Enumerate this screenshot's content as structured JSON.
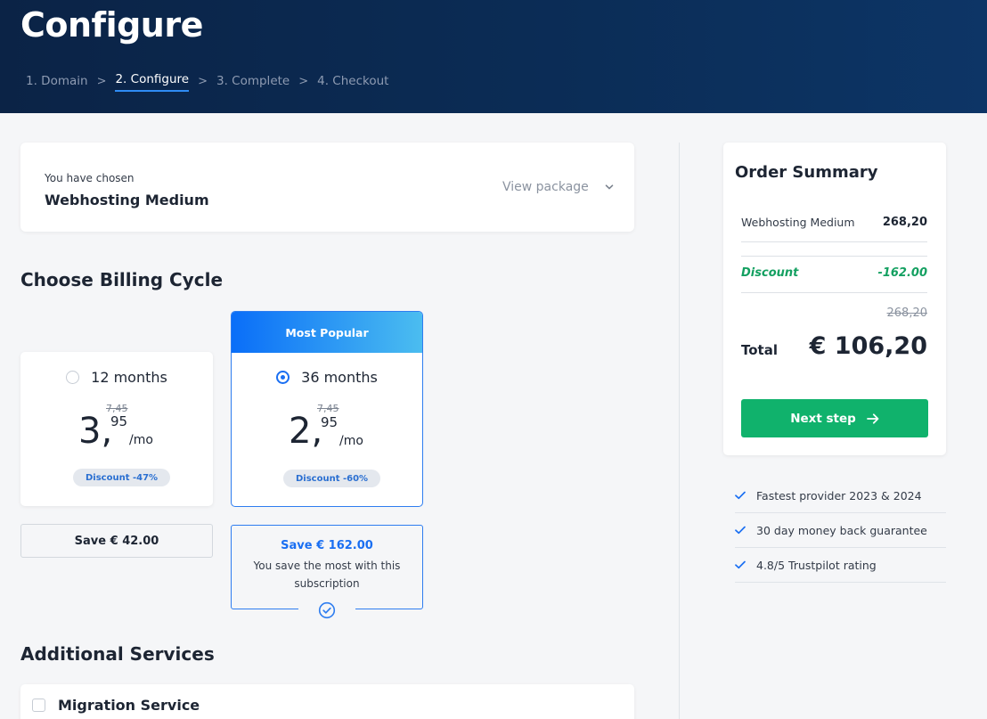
{
  "header": {
    "title": "Configure",
    "breadcrumbs": [
      "1. Domain",
      "2. Configure",
      "3. Complete",
      "4. Checkout"
    ],
    "active_step": 1
  },
  "chosen": {
    "intro": "You have chosen",
    "package": "Webhosting Medium",
    "view_label": "View package"
  },
  "billing": {
    "title": "Choose Billing Cycle",
    "plans": [
      {
        "label": "12 months",
        "selected": false,
        "old_price": "7,45",
        "price_main": "3,",
        "price_cents": "95",
        "per": "/mo",
        "discount": "Discount -47%",
        "save": "Save € 42.00"
      },
      {
        "label": "36 months",
        "selected": true,
        "badge": "Most Popular",
        "old_price": "7,45",
        "price_main": "2,",
        "price_cents": "95",
        "per": "/mo",
        "discount": "Discount -60%",
        "save": "Save € 162.00",
        "save_note": "You save the most with this subscription"
      }
    ]
  },
  "additional": {
    "title": "Additional Services",
    "items": [
      {
        "label": "Migration Service",
        "checked": false
      }
    ]
  },
  "summary": {
    "title": "Order Summary",
    "item_name": "Webhosting Medium",
    "item_price": "268,20",
    "discount_label": "Discount",
    "discount_value": "-162.00",
    "original_total": "268,20",
    "total_label": "Total",
    "total_value": "€ 106,20",
    "next_label": "Next step"
  },
  "usps": [
    "Fastest provider 2023 & 2024",
    "30 day money back guarantee",
    "4.8/5 Trustpilot rating"
  ],
  "colors": {
    "header_bg": "#0b2346",
    "accent_blue": "#1a6ff2",
    "success_green": "#10b26c",
    "discount_green": "#14a061"
  }
}
